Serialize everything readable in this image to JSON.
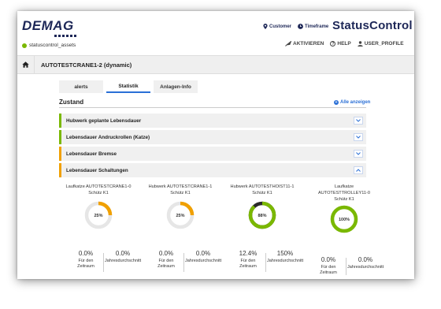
{
  "header": {
    "logo": "DEMAG",
    "asset": "statuscontrol_assets",
    "customer_link": "Customer",
    "timeframe_link": "Timeframe",
    "brand": "StatusControl",
    "actions": {
      "activate": "AKTIVIEREN",
      "help": "HELP",
      "profile": "USER_PROFILE"
    }
  },
  "breadcrumb": {
    "title": "AUTOTESTCRANE1-2 (dynamic)"
  },
  "tabs": [
    {
      "label": "alerts"
    },
    {
      "label": "Statistik",
      "active": true
    },
    {
      "label": "Anlagen-Info"
    }
  ],
  "section": {
    "title": "Zustand",
    "show_all": "Alle anzeigen"
  },
  "accordion": [
    {
      "label": "Hubwerk geplante Lebensdauer",
      "status": "green",
      "expanded": false
    },
    {
      "label": "Lebensdauer Andruckrollen (Katze)",
      "status": "green",
      "expanded": false
    },
    {
      "label": "Lebensdauer Bremse",
      "status": "orange",
      "expanded": false
    },
    {
      "label": "Lebensdauer Schaltungen",
      "status": "orange",
      "expanded": true
    }
  ],
  "gauges": [
    {
      "title_line1": "Laufkatze AUTOTESTCRANE1-0",
      "title_line2": "Schütz K1",
      "title_line3": "",
      "percent_label": "25%",
      "fraction": 0.25,
      "color": "#f0a000",
      "stat1_value": "0.0%",
      "stat1_label1": "Für den",
      "stat1_label2": "Zeitraum",
      "stat2_value": "0.0%",
      "stat2_label": "Jahresdurchschnitt"
    },
    {
      "title_line1": "Hubwerk AUTOTESTCRANE1-1",
      "title_line2": "Schütz K1",
      "title_line3": "",
      "percent_label": "25%",
      "fraction": 0.25,
      "color": "#f0a000",
      "stat1_value": "0.0%",
      "stat1_label1": "Für den",
      "stat1_label2": "Zeitraum",
      "stat2_value": "0.0%",
      "stat2_label": "Jahresdurchschnitt"
    },
    {
      "title_line1": "Hubwerk AUTOTESTHOIST11-1",
      "title_line2": "Schütz K1",
      "title_line3": "",
      "percent_label": "88%",
      "fraction": 0.88,
      "color": "#7ab800",
      "stat1_value": "12.4%",
      "stat1_label1": "Für den",
      "stat1_label2": "Zeitraum",
      "stat2_value": "150%",
      "stat2_label": "Jahresdurchschnitt"
    },
    {
      "title_line1": "Laufkatze",
      "title_line2": "AUTOTESTTROLLEY11-0",
      "title_line3": "Schütz K1",
      "percent_label": "100%",
      "fraction": 1.0,
      "color": "#7ab800",
      "stat1_value": "0.0%",
      "stat1_label1": "Für den",
      "stat1_label2": "Zeitraum",
      "stat2_value": "0.0%",
      "stat2_label": "Jahresdurchschnitt"
    }
  ],
  "colors": {
    "brand": "#1d2757",
    "ok": "#7ab800",
    "warn": "#f0a000",
    "link": "#2a6fd6"
  }
}
